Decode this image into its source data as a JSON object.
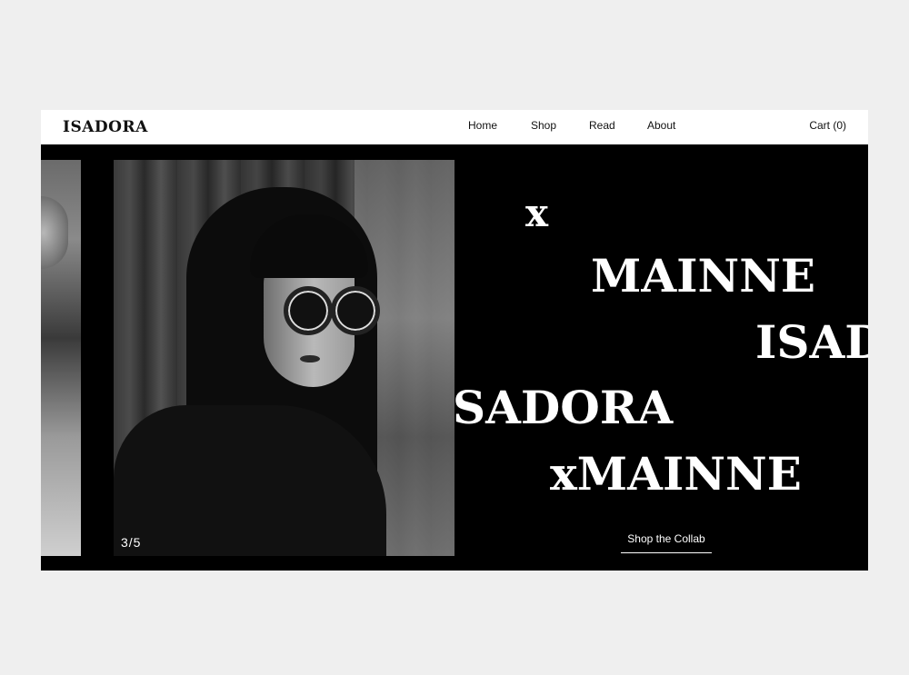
{
  "header": {
    "logo": "ISADORA",
    "nav": [
      {
        "label": "Home"
      },
      {
        "label": "Shop"
      },
      {
        "label": "Read"
      },
      {
        "label": "About"
      }
    ],
    "cart_label": "Cart (0)"
  },
  "hero": {
    "words": [
      "x",
      "MAINNE",
      "ISAD",
      "SADORA",
      "xMAINNE"
    ],
    "slide_counter": "3/5",
    "cta_label": "Shop the Collab"
  },
  "colors": {
    "background": "#efefef",
    "hero_bg": "#000000",
    "header_bg": "#ffffff",
    "text_dark": "#111111",
    "text_light": "#ffffff"
  }
}
